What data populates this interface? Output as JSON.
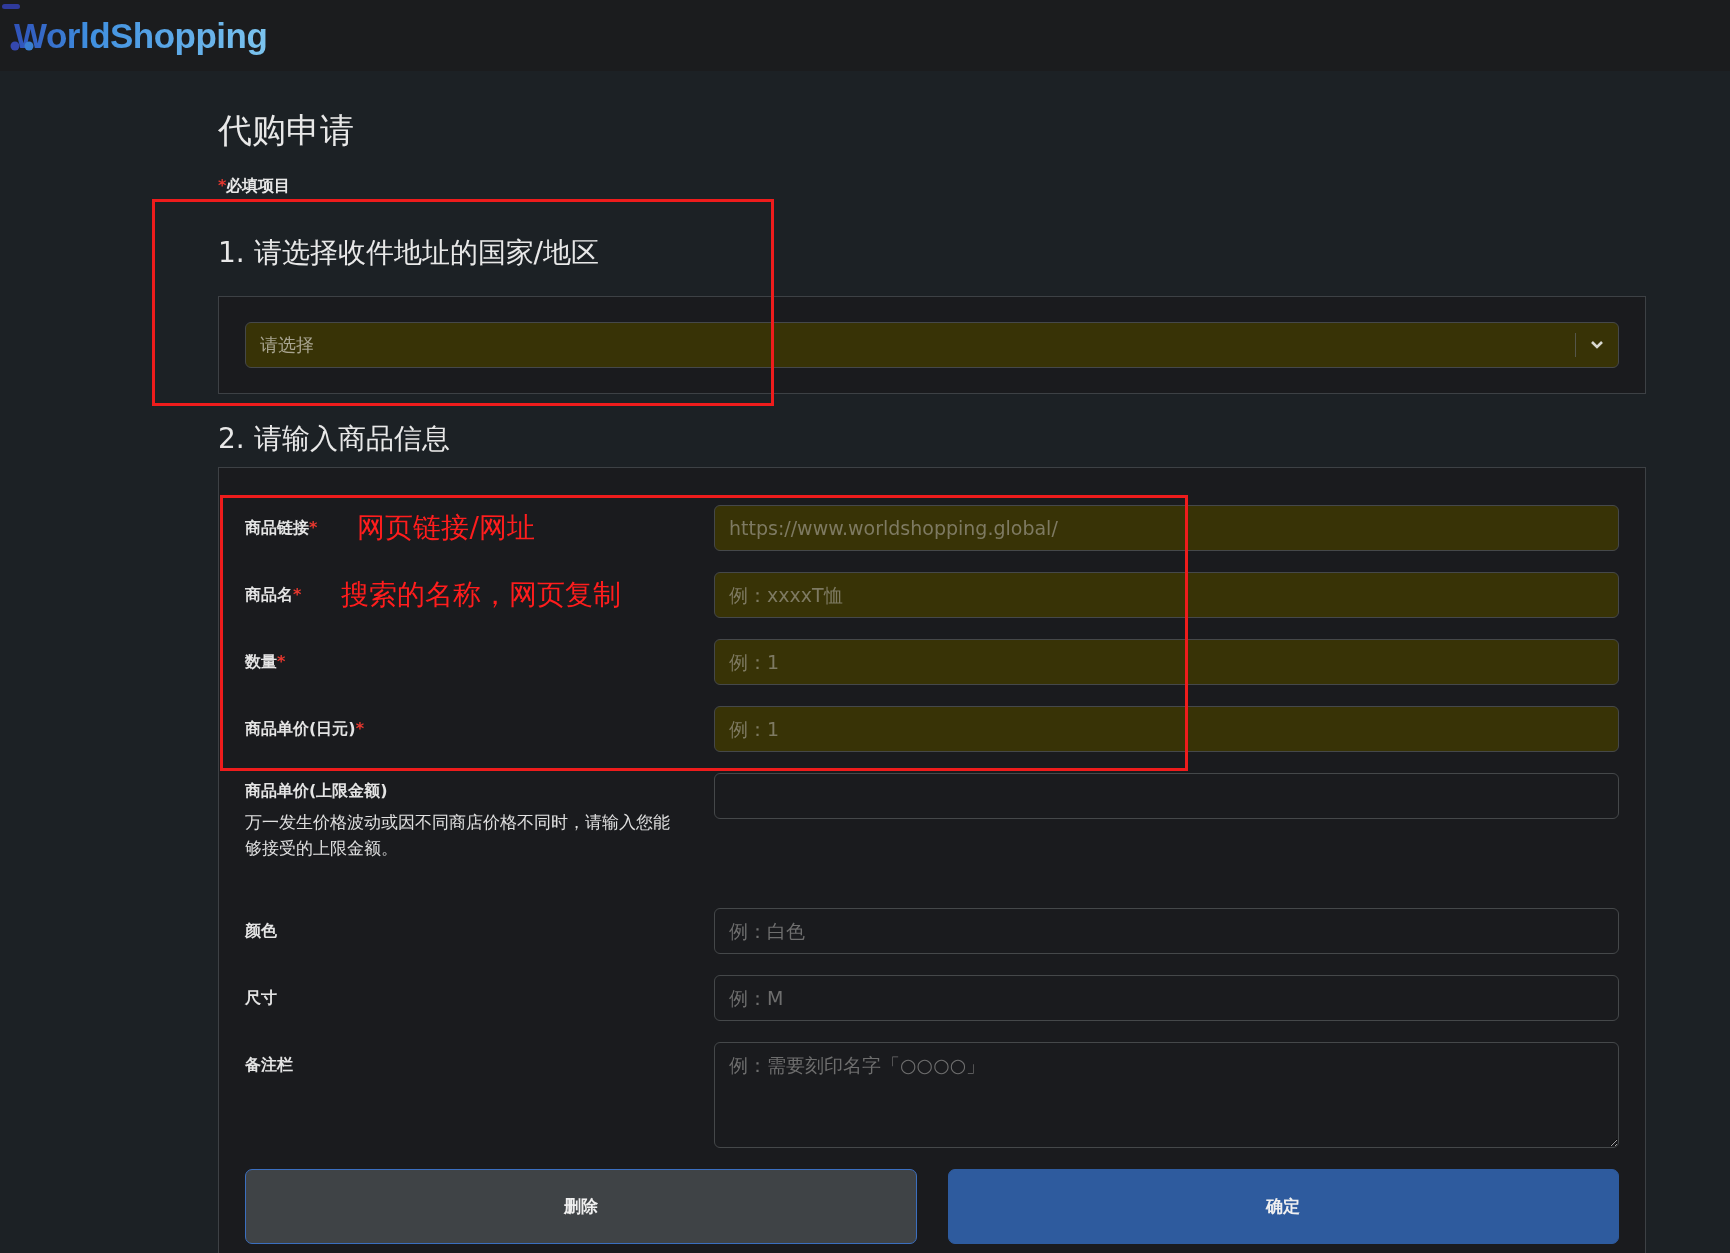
{
  "header": {
    "logo": "WorldShopping"
  },
  "page": {
    "title": "代购申请",
    "required_note": {
      "mark": "*",
      "text": "必填项目"
    }
  },
  "country_section": {
    "heading": "1. 请选择收件地址的国家/地区",
    "select": {
      "placeholder": "请选择",
      "highlighted": true
    }
  },
  "product_section": {
    "heading": "2. 请输入商品信息",
    "fields": [
      {
        "kind": "input",
        "label": "商品链接",
        "mark": "*",
        "annotation": "网页链接/网址",
        "placeholder": "https://www.worldshopping.global/",
        "highlighted": true
      },
      {
        "kind": "input",
        "label": "商品名",
        "mark": "*",
        "annotation": "搜索的名称，网页复制",
        "placeholder": "例：xxxxT恤",
        "highlighted": true
      },
      {
        "kind": "input",
        "label": "数量",
        "mark": "*",
        "placeholder": "例：1",
        "highlighted": true
      },
      {
        "kind": "input",
        "label": "商品单价(日元)",
        "mark": "*",
        "placeholder": "例：1",
        "highlighted": true
      },
      {
        "kind": "input",
        "label": "商品单价(上限金额)",
        "hint": "万一发生价格波动或因不同商店价格不同时，请输入您能够接受的上限金额。",
        "highlighted": false
      },
      {
        "kind": "input",
        "label": "颜色",
        "placeholder": "例：白色",
        "highlighted": false
      },
      {
        "kind": "input",
        "label": "尺寸",
        "placeholder": "例：M",
        "highlighted": false
      },
      {
        "kind": "textarea",
        "label": "备注栏",
        "placeholder": "例：需要刻印名字「○○○○」",
        "highlighted": false
      }
    ],
    "buttons": [
      {
        "kind": "secondary",
        "label": "删除"
      },
      {
        "kind": "primary",
        "label": "确定"
      }
    ]
  }
}
